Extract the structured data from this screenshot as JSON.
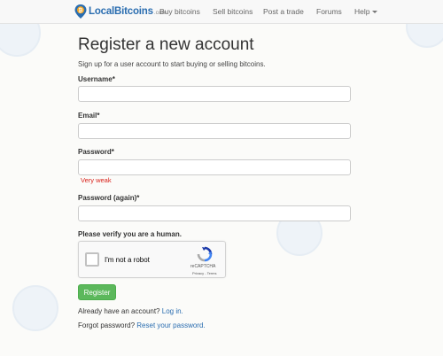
{
  "brand": {
    "name": "LocalBitcoins",
    "suffix": ".com",
    "color": "#2a6db0"
  },
  "nav": {
    "buy": "Buy bitcoins",
    "sell": "Sell bitcoins",
    "post": "Post a trade",
    "forums": "Forums",
    "help": "Help"
  },
  "form": {
    "title": "Register a new account",
    "subtitle": "Sign up for a user account to start buying or selling bitcoins.",
    "username": {
      "label": "Username",
      "required": "*",
      "value": ""
    },
    "email": {
      "label": "Email",
      "required": "*",
      "value": ""
    },
    "password": {
      "label": "Password",
      "required": "*",
      "value": "",
      "strength": "Very weak"
    },
    "password_again": {
      "label": "Password (again)",
      "required": "*",
      "value": ""
    },
    "verify_label": "Please verify you are a human.",
    "recaptcha": {
      "checkbox_label": "I'm not a robot",
      "brand": "reCAPTCHA",
      "privacy": "Privacy",
      "sep": " - ",
      "terms": "Terms",
      "checked": false
    },
    "submit": "Register",
    "have_account": "Already have an account?",
    "login_link": "Log in.",
    "forgot": "Forgot password?",
    "reset_link": "Reset your password."
  },
  "colors": {
    "accent": "#2a6db0",
    "success": "#5cb85c",
    "danger": "#d9231c"
  }
}
